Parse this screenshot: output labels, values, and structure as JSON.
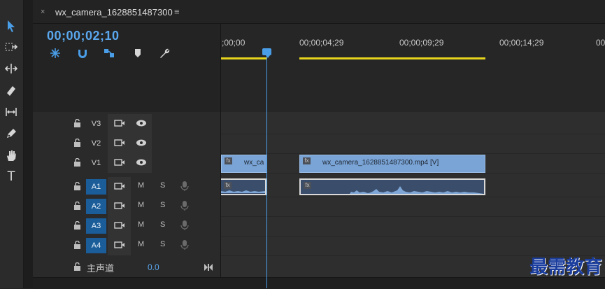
{
  "sequence": {
    "tab_title": "wx_camera_1628851487300",
    "tab_close": "×",
    "tab_menu": "≡",
    "timecode": "00;00;02;10"
  },
  "ruler": {
    "labels": [
      ";00;00",
      "00;00;04;29",
      "00;00;09;29",
      "00;00;14;29",
      "00;"
    ]
  },
  "tracks": {
    "video": [
      {
        "name": "V3",
        "targeted": false
      },
      {
        "name": "V2",
        "targeted": false
      },
      {
        "name": "V1",
        "targeted": false
      }
    ],
    "audio": [
      {
        "name": "A1",
        "targeted": true,
        "mute": "M",
        "solo": "S"
      },
      {
        "name": "A2",
        "targeted": true,
        "mute": "M",
        "solo": "S"
      },
      {
        "name": "A3",
        "targeted": true,
        "mute": "M",
        "solo": "S"
      },
      {
        "name": "A4",
        "targeted": true,
        "mute": "M",
        "solo": "S"
      }
    ],
    "master": {
      "name": "主声道",
      "value": "0.0"
    }
  },
  "clips": {
    "v1_left": "wx_ca",
    "v1_main": "wx_camera_1628851487300.mp4 [V]",
    "fx_badge": "fx"
  },
  "colors": {
    "accent": "#4a9ee8",
    "timecode": "#5aa7ee",
    "work_area": "#e6d41c",
    "audio_target": "#1a5d99",
    "video_clip": "#7aa4d6",
    "audio_clip": "#3a4d6a"
  },
  "watermark": "最需教育"
}
